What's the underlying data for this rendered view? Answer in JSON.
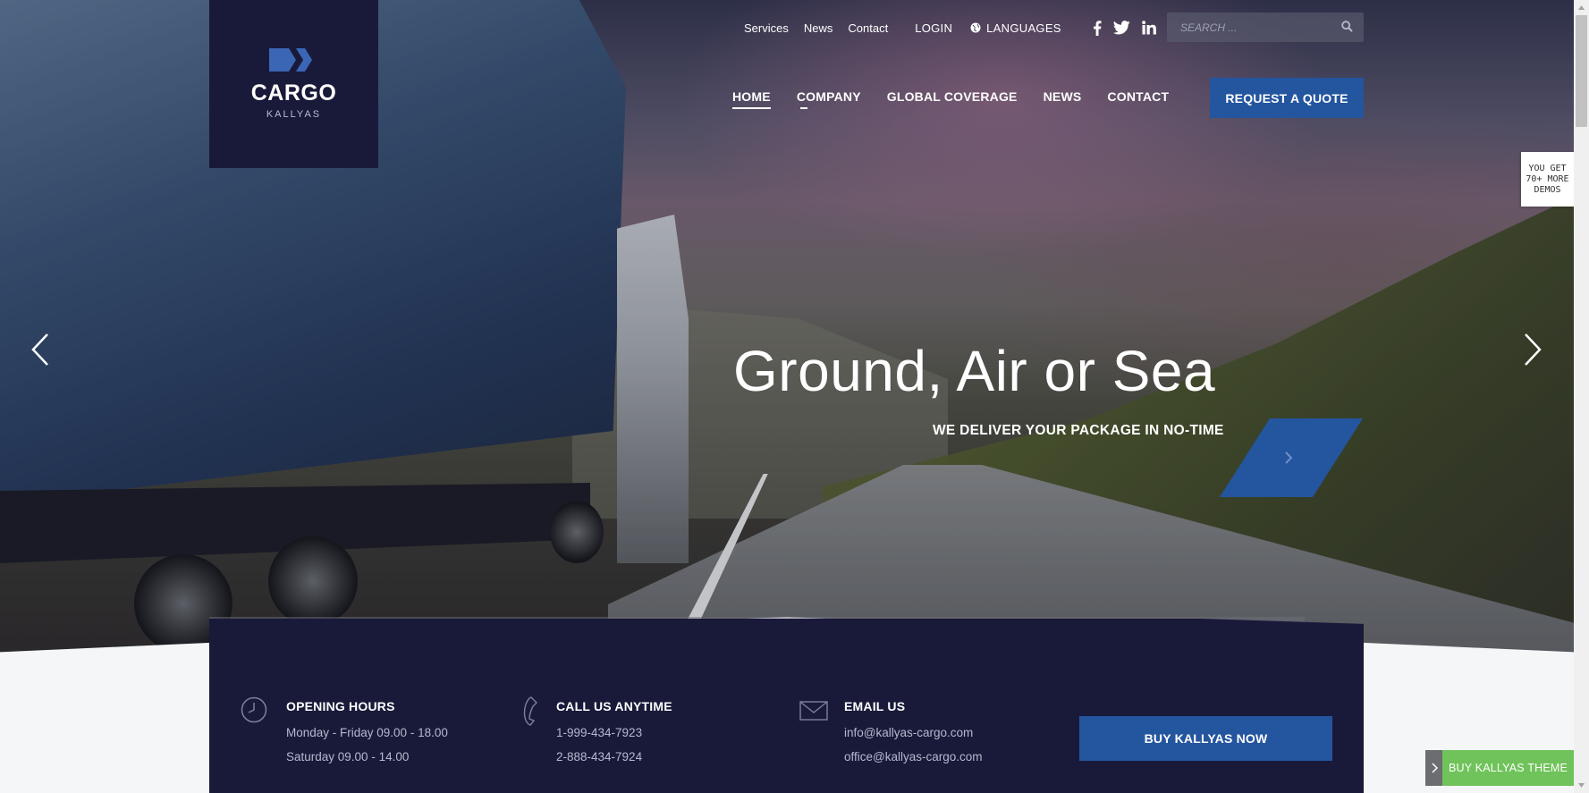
{
  "logo": {
    "title": "CARGO",
    "subtitle": "KALLYAS",
    "brand_color": "#191a3a"
  },
  "topbar": {
    "links": [
      "Services",
      "News",
      "Contact"
    ],
    "login": "LOGIN",
    "languages": "LANGUAGES",
    "social_icons": [
      "facebook-icon",
      "twitter-icon",
      "linkedin-icon"
    ],
    "search": {
      "placeholder": "SEARCH ..."
    }
  },
  "nav": {
    "items": [
      "HOME",
      "COMPANY",
      "GLOBAL COVERAGE",
      "NEWS",
      "CONTACT"
    ],
    "active": "HOME",
    "quote_button": "REQUEST A QUOTE"
  },
  "side_tag": {
    "lines": [
      "YOU GET",
      "70+ MORE",
      "DEMOS"
    ]
  },
  "slide": {
    "title": "Ground, Air or Sea",
    "subtitle": "WE DELIVER YOUR PACKAGE IN NO-TIME"
  },
  "info": {
    "hours": {
      "title": "OPENING HOURS",
      "lines": [
        "Monday - Friday 09.00 - 18.00",
        "Saturday 09.00 - 14.00"
      ]
    },
    "call": {
      "title": "CALL US ANYTIME",
      "lines": [
        "1-999-434-7923",
        "2-888-434-7924"
      ]
    },
    "email": {
      "title": "EMAIL US",
      "lines": [
        "info@kallyas-cargo.com",
        "office@kallyas-cargo.com"
      ]
    },
    "buy_button": "BUY KALLYAS NOW"
  },
  "theme_tab": {
    "label": "BUY KALLYAS THEME"
  },
  "colors": {
    "accent": "#24559f",
    "panel": "#191a3a",
    "green": "#6fc35a"
  }
}
